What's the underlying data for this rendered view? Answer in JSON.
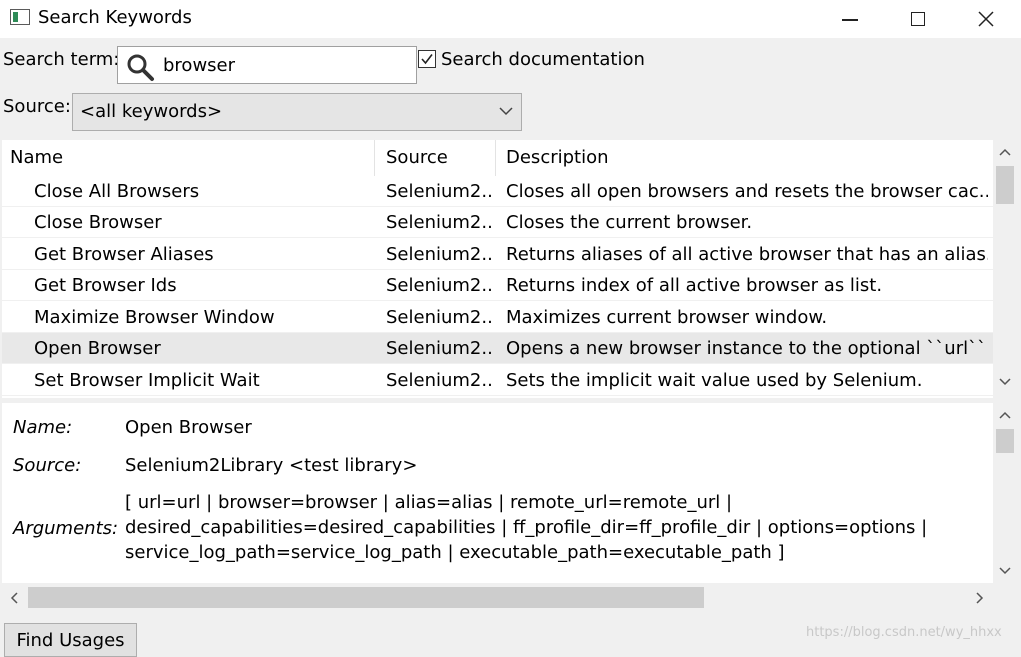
{
  "window": {
    "title": "Search Keywords",
    "controls": {
      "minimize_icon": "minimize-icon",
      "maximize_icon": "maximize-icon",
      "close_icon": "close-icon"
    }
  },
  "search": {
    "label": "Search term:",
    "value": "browser",
    "icon": "search-icon",
    "documentation_checked": true,
    "documentation_label": "Search documentation"
  },
  "source": {
    "label": "Source:",
    "selected": "<all keywords>"
  },
  "table": {
    "columns": [
      "Name",
      "Source",
      "Description"
    ],
    "rows": [
      {
        "name": "Close All Browsers",
        "source": "Selenium2...",
        "description": "Closes all open browsers and resets the browser cac..."
      },
      {
        "name": "Close Browser",
        "source": "Selenium2...",
        "description": "Closes the current browser."
      },
      {
        "name": "Get Browser Aliases",
        "source": "Selenium2...",
        "description": "Returns aliases of all active browser that has an alias..."
      },
      {
        "name": "Get Browser Ids",
        "source": "Selenium2...",
        "description": "Returns index of all active browser as list."
      },
      {
        "name": "Maximize Browser Window",
        "source": "Selenium2...",
        "description": "Maximizes current browser window."
      },
      {
        "name": "Open Browser",
        "source": "Selenium2...",
        "description": "Opens a new browser instance to the optional ``url``."
      },
      {
        "name": "Set Browser Implicit Wait",
        "source": "Selenium2...",
        "description": "Sets the implicit wait value used by Selenium."
      }
    ],
    "selected_index": 5
  },
  "details": {
    "name_label": "Name:",
    "name_value": "Open Browser",
    "source_label": "Source:",
    "source_value": "Selenium2Library <test library>",
    "arguments_label": "Arguments:",
    "arguments_lines": [
      "[ url=url | browser=browser | alias=alias | remote_url=remote_url |",
      "desired_capabilities=desired_capabilities | ff_profile_dir=ff_profile_dir | options=options |",
      "service_log_path=service_log_path | executable_path=executable_path ]"
    ]
  },
  "buttons": {
    "find_usages": "Find Usages"
  },
  "watermark": "https://blog.csdn.net/wy_hhxx"
}
